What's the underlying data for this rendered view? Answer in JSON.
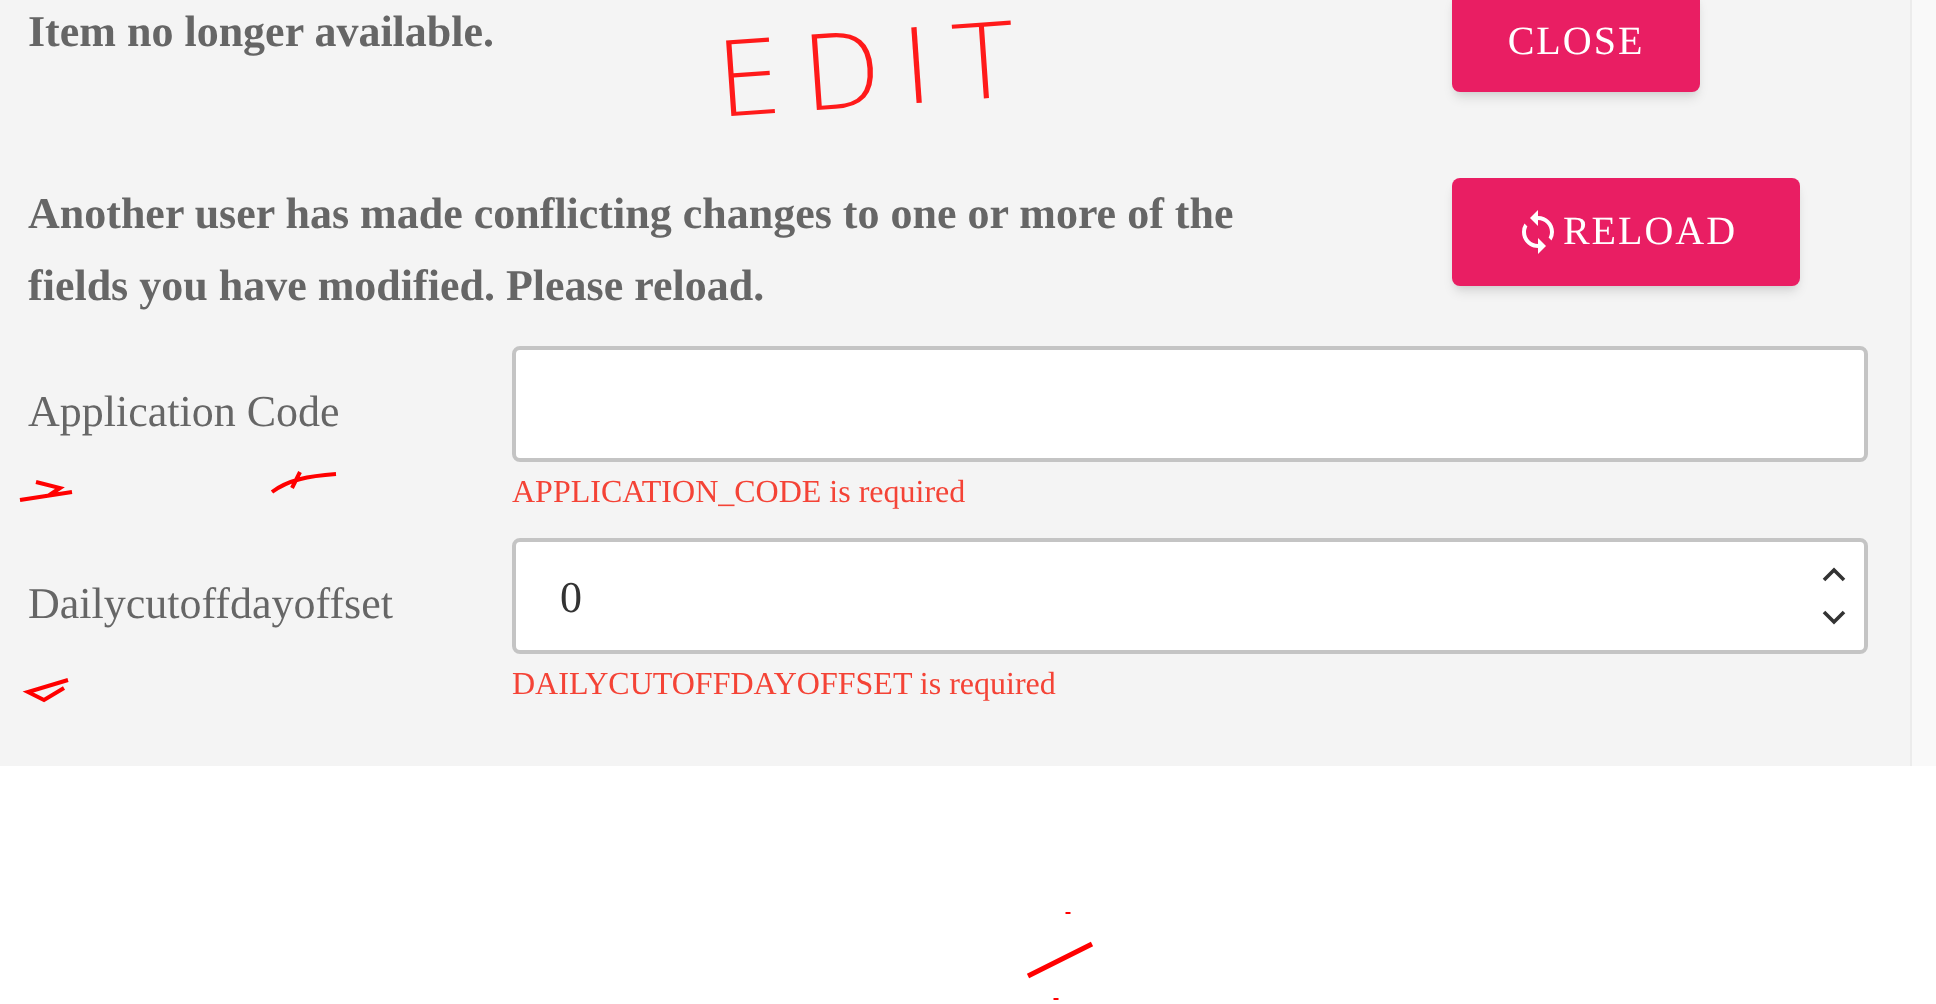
{
  "messages": [
    {
      "text": "Item no longer available.",
      "button": {
        "label": "CLOSE",
        "kind": "plain"
      }
    },
    {
      "text": "Another user has made conflicting changes to one or more of the fields you have modified. Please reload.",
      "button": {
        "label": "RELOAD",
        "kind": "reload"
      }
    }
  ],
  "fields": [
    {
      "label": "Application Code",
      "kind": "text",
      "error": "APPLICATION_CODE is required"
    },
    {
      "label": "Dailycutoffdayoffset",
      "kind": "number",
      "value": "0",
      "error": "DAILYCUTOFFDAYOFFSET is required"
    }
  ],
  "annotation": {
    "text": "EDIT"
  }
}
